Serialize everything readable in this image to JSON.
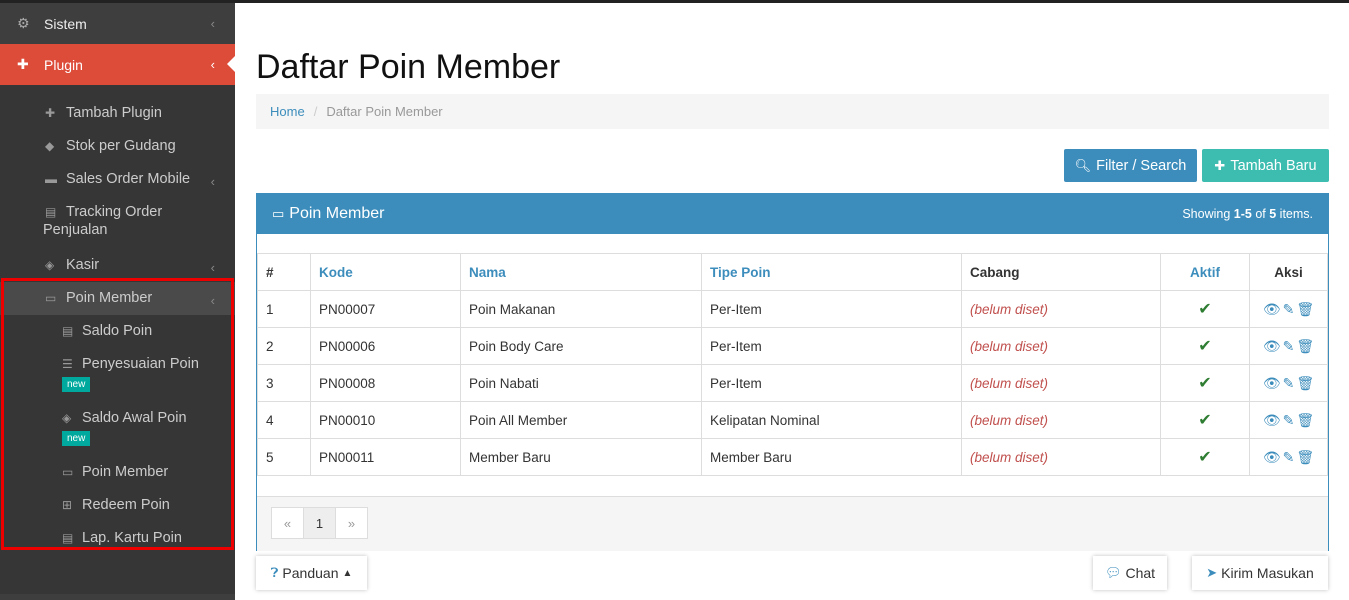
{
  "sidebar": {
    "sistem": {
      "label": "Sistem",
      "icon": "gears-icon"
    },
    "plugin": {
      "label": "Plugin",
      "icon": "puzzle-icon"
    },
    "items": [
      {
        "label": "Tambah Plugin",
        "icon": "plus-icon"
      },
      {
        "label": "Stok per Gudang",
        "icon": "cube-icon"
      },
      {
        "label": "Sales Order Mobile",
        "icon": "truck-icon"
      },
      {
        "label": "Tracking Order Penjualan",
        "icon": "book-icon"
      },
      {
        "label": "Kasir",
        "icon": "tags-icon"
      },
      {
        "label": "Poin Member",
        "icon": "credit-card-icon"
      }
    ],
    "poin_member_items": [
      {
        "label": "Saldo Poin",
        "icon": "book-icon"
      },
      {
        "label": "Penyesuaian Poin",
        "icon": "sliders-icon",
        "badge": "new"
      },
      {
        "label": "Saldo Awal Poin",
        "icon": "tag-icon",
        "badge": "new"
      },
      {
        "label": "Poin Member",
        "icon": "credit-card-icon"
      },
      {
        "label": "Redeem Poin",
        "icon": "gift-icon"
      },
      {
        "label": "Lap. Kartu Poin",
        "icon": "book-icon"
      }
    ]
  },
  "page": {
    "title": "Daftar Poin Member",
    "breadcrumb": {
      "home": "Home",
      "current": "Daftar Poin Member"
    },
    "filter_button": "Filter / Search",
    "add_button": "Tambah Baru"
  },
  "panel": {
    "title": "Poin Member",
    "summary": {
      "prefix": "Showing ",
      "range": "1-5",
      "mid": " of ",
      "total": "5",
      "suffix": " items."
    }
  },
  "table": {
    "headers": [
      "#",
      "Kode",
      "Nama",
      "Tipe Poin",
      "Cabang",
      "Aktif",
      "Aksi"
    ],
    "rows": [
      {
        "no": "1",
        "kode": "PN00007",
        "nama": "Poin Makanan",
        "tipe": "Per-Item",
        "cabang": "(belum diset)"
      },
      {
        "no": "2",
        "kode": "PN00006",
        "nama": "Poin Body Care",
        "tipe": "Per-Item",
        "cabang": "(belum diset)"
      },
      {
        "no": "3",
        "kode": "PN00008",
        "nama": "Poin Nabati",
        "tipe": "Per-Item",
        "cabang": "(belum diset)"
      },
      {
        "no": "4",
        "kode": "PN00010",
        "nama": "Poin All Member",
        "tipe": "Kelipatan Nominal",
        "cabang": "(belum diset)"
      },
      {
        "no": "5",
        "kode": "PN00011",
        "nama": "Member Baru",
        "tipe": "Member Baru",
        "cabang": "(belum diset)"
      }
    ]
  },
  "pagination": {
    "prev": "«",
    "current": "1",
    "next": "»"
  },
  "footer": {
    "panduan": "Panduan",
    "chat": "Chat",
    "kirim": "Kirim Masukan"
  },
  "colors": {
    "accent": "#3c8dbc",
    "active_menu": "#dd4b39",
    "add_button": "#3dbcb0",
    "unset_text": "#c0504d"
  }
}
